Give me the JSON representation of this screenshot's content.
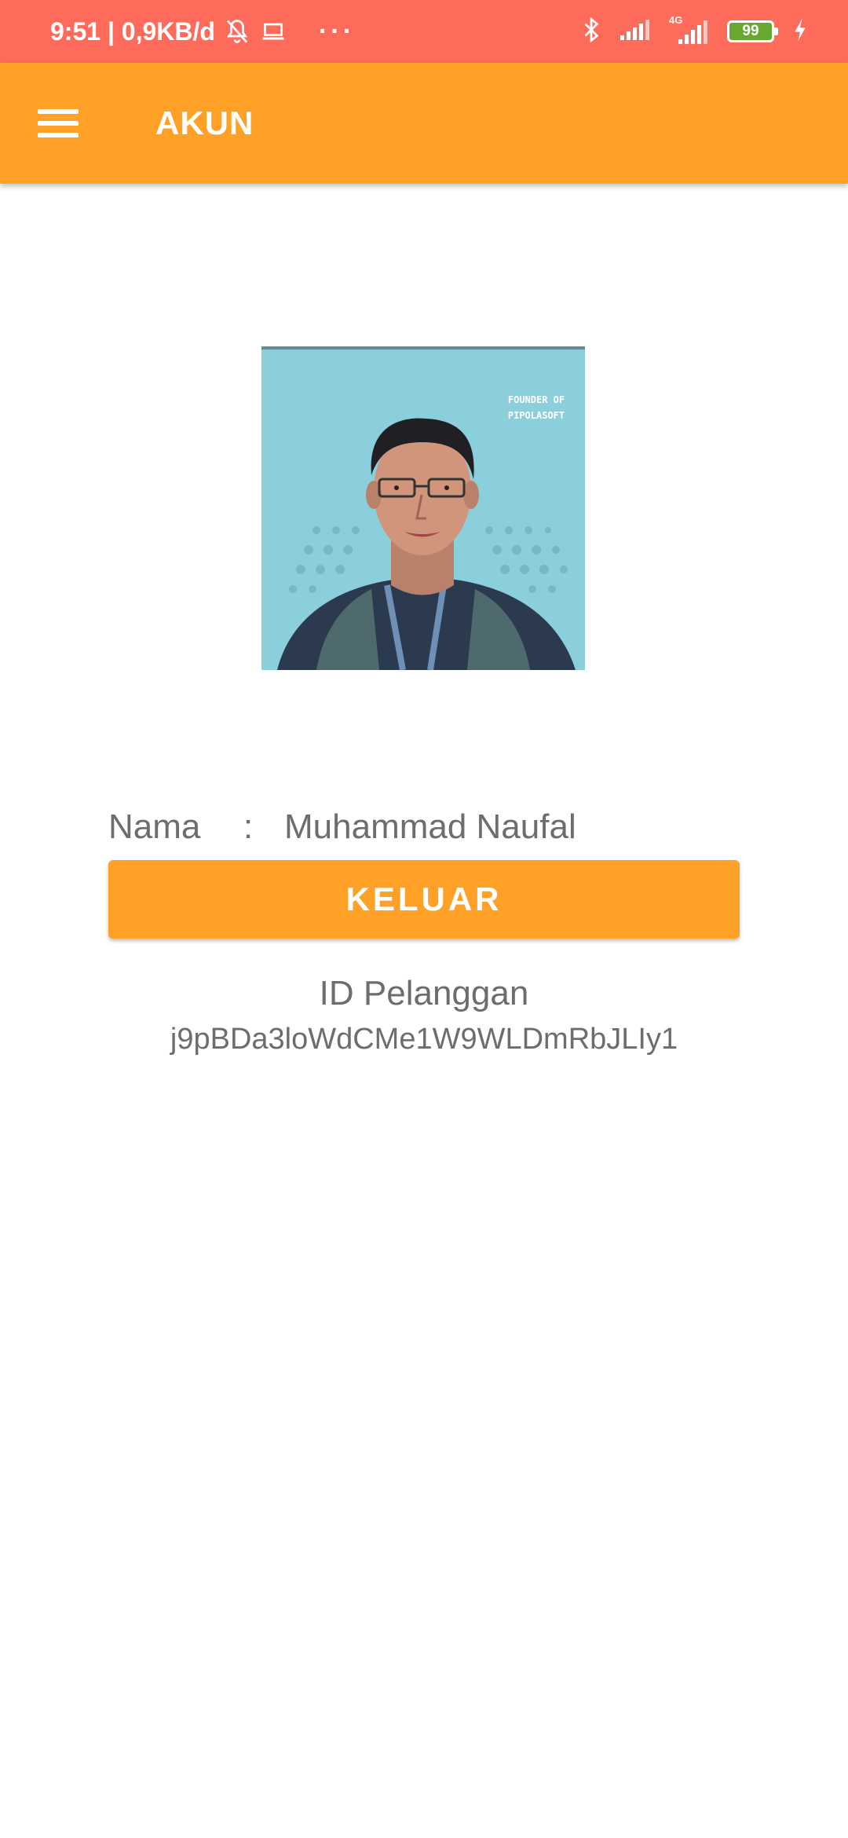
{
  "status_bar": {
    "time_speed": "9:51 | 0,9KB/d",
    "more": "···",
    "network_label": "4G",
    "battery": "99",
    "icons": [
      "mute-icon",
      "laptop-icon",
      "bluetooth-icon",
      "signal-icon",
      "signal-4g-icon",
      "battery-icon",
      "charging-icon"
    ],
    "color": "#ff6b5b"
  },
  "app_bar": {
    "title": "AKUN",
    "menu_icon": "hamburger-menu-icon",
    "color": "#ffa126"
  },
  "profile": {
    "name_label": "Nama",
    "separator": ":",
    "name_value": "Muhammad Naufal",
    "avatar_caption": "FOUNDER OF PIPOLASOFT"
  },
  "actions": {
    "logout_label": "KELUAR"
  },
  "customer": {
    "id_label": "ID Pelanggan",
    "id_value": "j9pBDa3loWdCMe1W9WLDmRbJLIy1"
  }
}
